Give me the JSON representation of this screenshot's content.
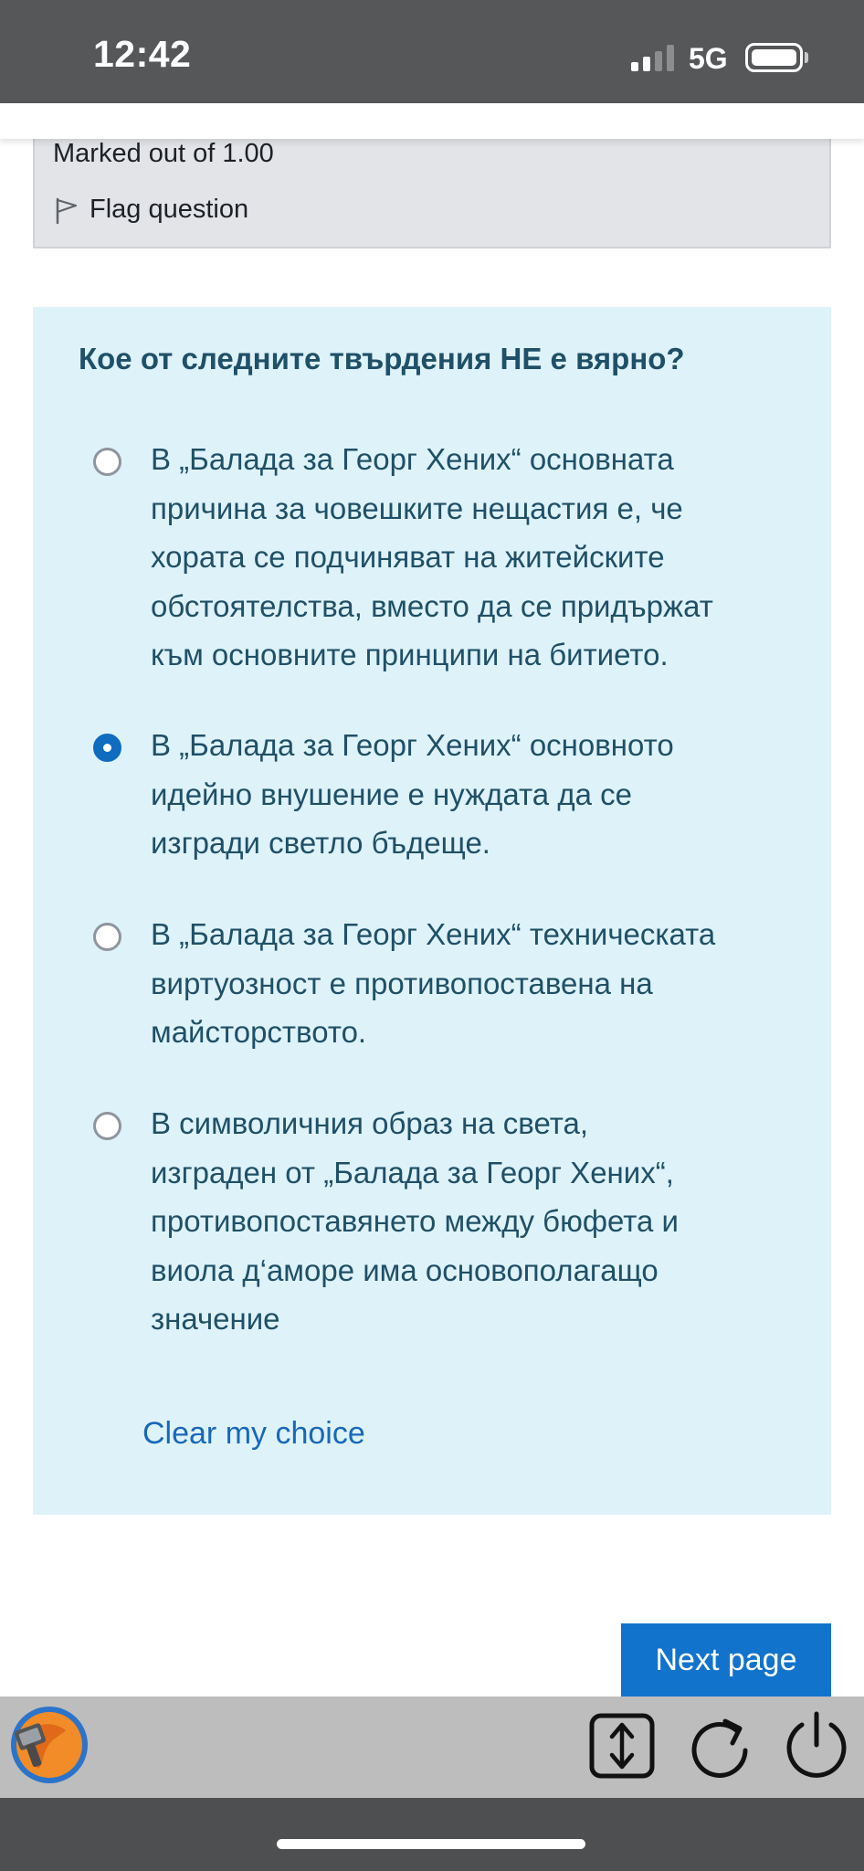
{
  "status_bar": {
    "time": "12:42",
    "network": "5G",
    "signal_bars_active": 2,
    "signal_bars_total": 4,
    "battery_icon": "battery-full-icon"
  },
  "info": {
    "marked_out": "Marked out of 1.00",
    "flag_label": "Flag question",
    "flag_icon": "flag-outline-icon"
  },
  "question": {
    "text": "Кое от следните твърдения НЕ е вярно?",
    "options": [
      {
        "lines": [
          "В „Балада за Георг Хених“ основната",
          "причина за човешките нещастия е, че",
          "хората се подчиняват на житейските",
          "обстоятелства, вместо да се придържат",
          "към основните принципи на битието."
        ],
        "selected": false
      },
      {
        "lines": [
          "В „Балада за Георг Хених“ основното",
          "идейно внушение е нуждата да се",
          "изгради светло бъдеще."
        ],
        "selected": true
      },
      {
        "lines": [
          "В „Балада за Георг Хених“ техническата",
          "виртуозност е противопоставена на",
          "майсторството."
        ],
        "selected": false
      },
      {
        "lines": [
          "В символичния образ на света,",
          "изграден от „Балада за Георг Хених“,",
          "противопоставянето между бюфета и",
          "виола д‘аморе има основополагащо",
          "значение"
        ],
        "selected": false
      }
    ],
    "clear_label": "Clear my choice"
  },
  "nav": {
    "next_label": "Next page"
  },
  "colors": {
    "panel_bg": "#def2f9",
    "question_text": "#1f5067",
    "link": "#1868b8",
    "primary_button": "#1273cc",
    "radio_selected": "#0f6cbf"
  },
  "toolbar": {
    "icons": [
      "app-logo-icon",
      "scroll-arrows-icon",
      "reload-icon",
      "power-icon"
    ]
  }
}
